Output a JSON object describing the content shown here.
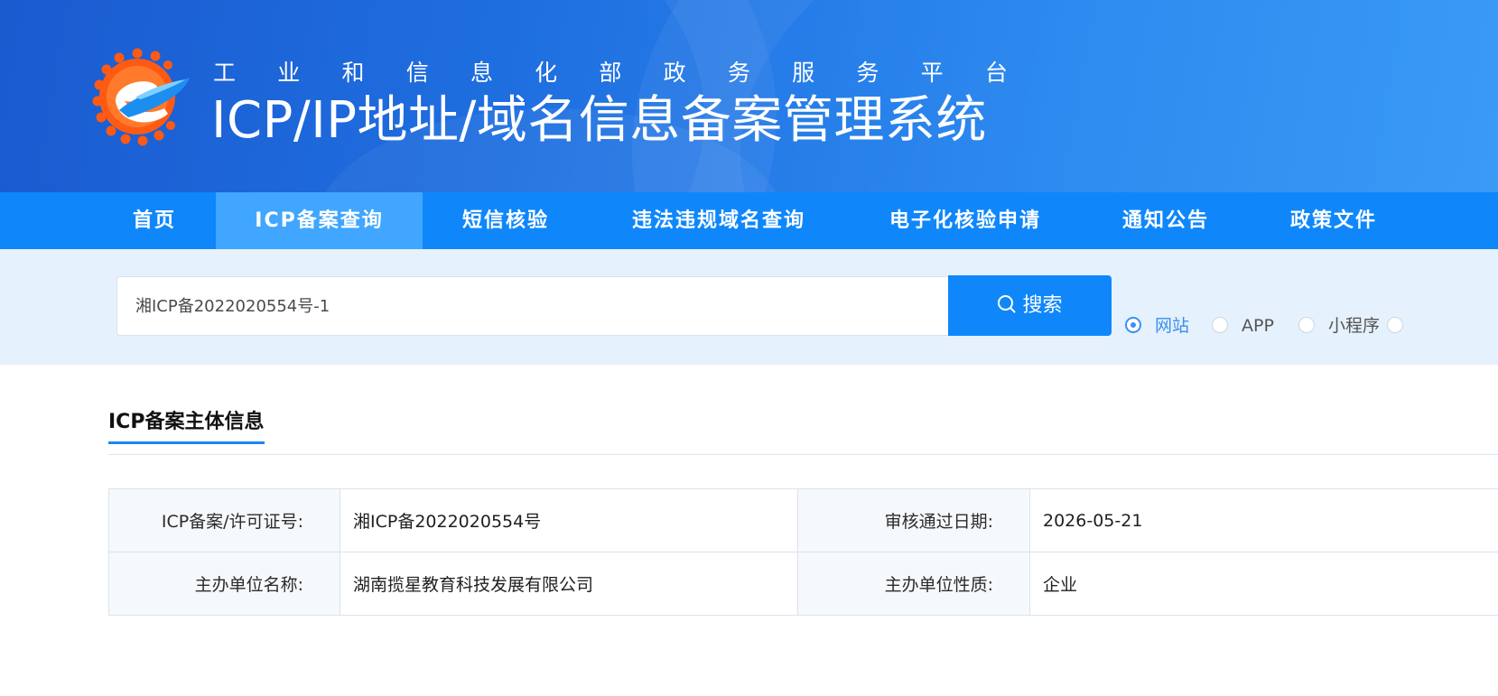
{
  "header": {
    "subtitle_chars": [
      "工",
      "业",
      "和",
      "信",
      "息",
      "化",
      "部",
      "政",
      "务",
      "服",
      "务",
      "平",
      "台"
    ],
    "title": "ICP/IP地址/域名信息备案管理系统",
    "logo_icon": "miit-e-logo-icon",
    "colors": {
      "banner": "#1f6fe0",
      "logo_orange": "#ff5a14",
      "logo_blue": "#1b8ef0"
    }
  },
  "nav": {
    "items": [
      {
        "label": "首页",
        "active": false
      },
      {
        "label": "ICP备案查询",
        "active": true
      },
      {
        "label": "短信核验",
        "active": false
      },
      {
        "label": "违法违规域名查询",
        "active": false
      },
      {
        "label": "电子化核验申请",
        "active": false
      },
      {
        "label": "通知公告",
        "active": false
      },
      {
        "label": "政策文件",
        "active": false
      }
    ],
    "colors": {
      "bar": "#0f87fb",
      "active": "#40a6ff"
    }
  },
  "search": {
    "value": "湘ICP备2022020554号-1",
    "button_label": "搜索",
    "button_icon": "search-icon",
    "options": [
      {
        "label": "网站",
        "checked": true
      },
      {
        "label": "APP",
        "checked": false
      },
      {
        "label": "小程序",
        "checked": false
      },
      {
        "label": "",
        "checked": false
      }
    ]
  },
  "section": {
    "title": "ICP备案主体信息"
  },
  "info": {
    "rows": [
      {
        "k1": "ICP备案/许可证号:",
        "v1": "湘ICP备2022020554号",
        "k2": "审核通过日期:",
        "v2": "2026-05-21"
      },
      {
        "k1": "主办单位名称:",
        "v1": "湖南揽星教育科技发展有限公司",
        "k2": "主办单位性质:",
        "v2": "企业"
      }
    ]
  }
}
